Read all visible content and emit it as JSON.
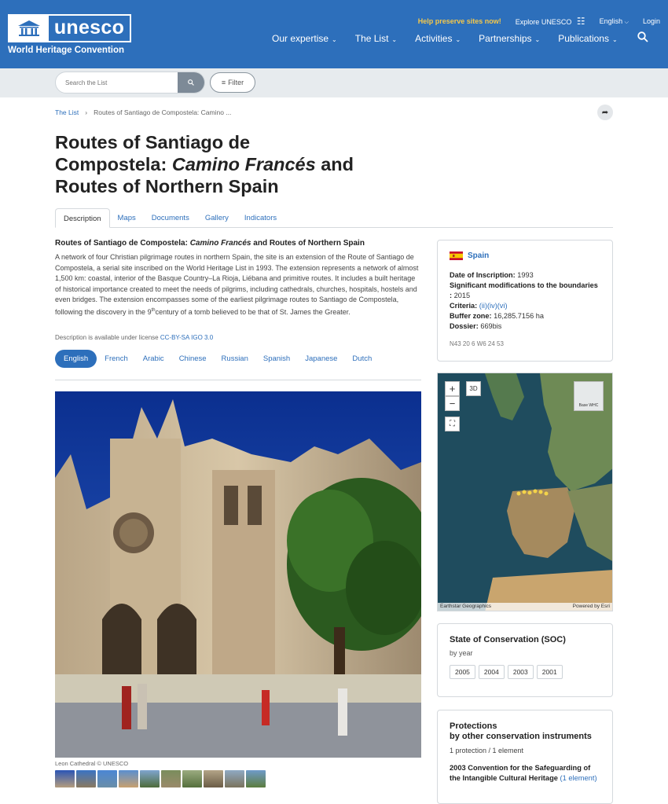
{
  "header": {
    "logo_text": "unesco",
    "subtitle": "World Heritage Convention",
    "top_links": [
      "Help preserve sites now!",
      "Explore UNESCO",
      "English",
      "Login"
    ],
    "nav": [
      "Our expertise",
      "The List",
      "Activities",
      "Partnerships",
      "Publications"
    ]
  },
  "search": {
    "placeholder": "Search the List",
    "filter_label": "Filter"
  },
  "breadcrumb": {
    "root": "The List",
    "current": "Routes of Santiago de Compostela: Camino ..."
  },
  "title": {
    "line1": "Routes of Santiago de",
    "line2a": "Compostela: ",
    "line2b": "Camino Francés",
    "line2c": " and",
    "line3": "Routes of Northern Spain"
  },
  "tabs": [
    "Description",
    "Maps",
    "Documents",
    "Gallery",
    "Indicators"
  ],
  "description": {
    "heading_a": "Routes of Santiago de Compostela: ",
    "heading_b": "Camino Francés",
    "heading_c": " and Routes of Northern Spain",
    "body_a": "A network of four Christian pilgrimage routes in northern Spain, the site is an extension of the Route of Santiago de Compostela, a serial site inscribed on the World Heritage List in 1993. The extension represents a network of almost 1,500 km: coastal, interior of the Basque Country–La Rioja, Liébana and primitive routes. It includes a built heritage of historical importance created to meet the needs of pilgrims, including cathedrals, churches, hospitals, hostels and even bridges. The extension encompasses some of the earliest pilgrimage routes to Santiago de Compostela, following the discovery in the 9",
    "body_sup": "th",
    "body_b": "century of a tomb believed to be that of St. James the Greater.",
    "license_text": "Description is available under license ",
    "license_link": "CC-BY-SA IGO 3.0"
  },
  "languages": [
    "English",
    "French",
    "Arabic",
    "Chinese",
    "Russian",
    "Spanish",
    "Japanese",
    "Dutch"
  ],
  "photo": {
    "caption": "Leon Cathedral © UNESCO"
  },
  "info": {
    "country": "Spain",
    "inscription_label": "Date of Inscription:",
    "inscription_value": "1993",
    "mod_label": "Significant modifications to the boundaries :",
    "mod_value": "2015",
    "criteria_label": "Criteria:",
    "criteria_value": "(ii)(iv)(vi)",
    "buffer_label": "Buffer zone:",
    "buffer_value": "16,285.7156 ha",
    "dossier_label": "Dossier:",
    "dossier_value": "669bis",
    "coords": "N43 20 6 W6 24 53"
  },
  "map": {
    "btn_3d": "3D",
    "basemap": "Base WHC",
    "credit_left": "Earthstar Geographics",
    "credit_right": "Powered by Esri"
  },
  "soc": {
    "title": "State of Conservation (SOC)",
    "sub": "by year",
    "years": [
      "2005",
      "2004",
      "2003",
      "2001"
    ]
  },
  "protections": {
    "title1": "Protections",
    "title2": "by other conservation instruments",
    "count": "1 protection / 1 element",
    "conv": "2003 Convention for the Safeguarding of the Intangible Cultural Heritage",
    "conv_count": "(1 element)"
  },
  "colors": {
    "brand": "#2d6fbb",
    "help": "#f5c84a"
  }
}
